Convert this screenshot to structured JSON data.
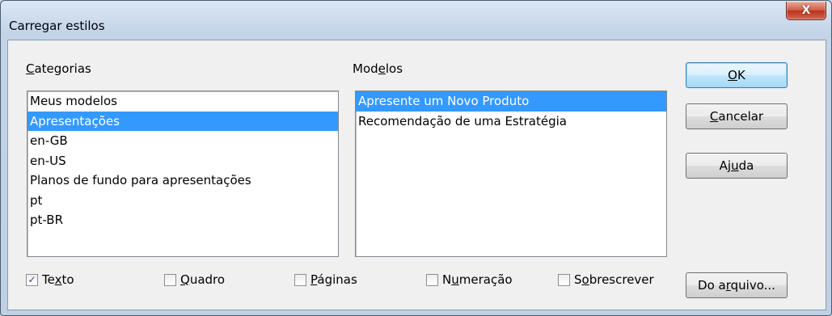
{
  "window": {
    "title": "Carregar estilos",
    "close_label": "X"
  },
  "categorias": {
    "label_pre": "",
    "label_u": "C",
    "label_post": "ategorias",
    "items": [
      "Meus modelos",
      "Apresentações",
      "en-GB",
      "en-US",
      "Planos de fundo para apresentações",
      "pt",
      "pt-BR"
    ],
    "selected_index": 1
  },
  "modelos": {
    "label_pre": "Mod",
    "label_u": "e",
    "label_post": "los",
    "items": [
      "Apresente um Novo Produto",
      "Recomendação de uma Estratégia"
    ],
    "selected_index": 0
  },
  "buttons": {
    "ok": {
      "pre": "",
      "u": "O",
      "post": "K"
    },
    "cancel": {
      "pre": "",
      "u": "C",
      "post": "ancelar"
    },
    "help": {
      "pre": "Aj",
      "u": "u",
      "post": "da"
    },
    "from_file": {
      "pre": "Do a",
      "u": "r",
      "post": "quivo..."
    }
  },
  "options": [
    {
      "pre": "Te",
      "u": "x",
      "post": "to",
      "checked": true
    },
    {
      "pre": "",
      "u": "Q",
      "post": "uadro",
      "checked": false
    },
    {
      "pre": "",
      "u": "P",
      "post": "áginas",
      "checked": false
    },
    {
      "pre": "N",
      "u": "u",
      "post": "meração",
      "checked": false
    },
    {
      "pre": "S",
      "u": "o",
      "post": "brescrever",
      "checked": false
    }
  ],
  "colors": {
    "selection": "#3399ff",
    "close": "#c75050"
  }
}
